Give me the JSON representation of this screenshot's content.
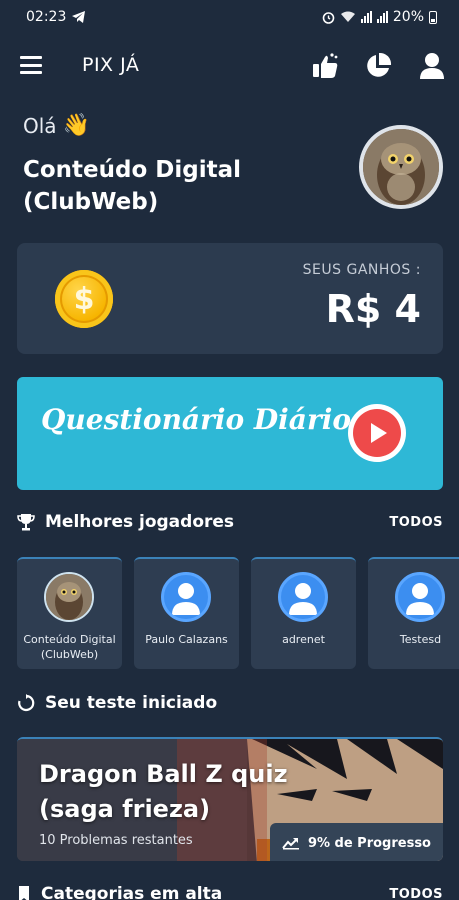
{
  "status": {
    "time": "02:23",
    "battery": "20%"
  },
  "app": {
    "title": "PIX JÁ"
  },
  "greeting": {
    "text": "Olá",
    "wave": "👋"
  },
  "user": {
    "name": "Conteúdo Digital (ClubWeb)"
  },
  "earnings": {
    "label": "SEUS GANHOS :",
    "value": "R$ 4",
    "coin_symbol": "$"
  },
  "quiz": {
    "title": "Questionário Diário"
  },
  "top_players": {
    "title": "Melhores jogadores",
    "link": "TODOS",
    "players": [
      {
        "name": "Conteúdo Digital (ClubWeb)",
        "avatar": "photo"
      },
      {
        "name": "Paulo Calazans",
        "avatar": "generic"
      },
      {
        "name": "adrenet",
        "avatar": "generic"
      },
      {
        "name": "Testesd",
        "avatar": "generic"
      }
    ]
  },
  "started_test": {
    "title": "Seu teste iniciado",
    "card_title": "Dragon Ball Z quiz (saga frieza)",
    "remaining": "10 Problemas restantes",
    "progress_label": "9% de Progresso",
    "progress": 9
  },
  "trending": {
    "title": "Categorias em alta",
    "link": "TODOS"
  },
  "colors": {
    "background": "#1e2b3d",
    "card": "#2c3b4f",
    "banner": "#2eb8d6",
    "play": "#ee4a4a",
    "accent": "#3b82b8"
  }
}
